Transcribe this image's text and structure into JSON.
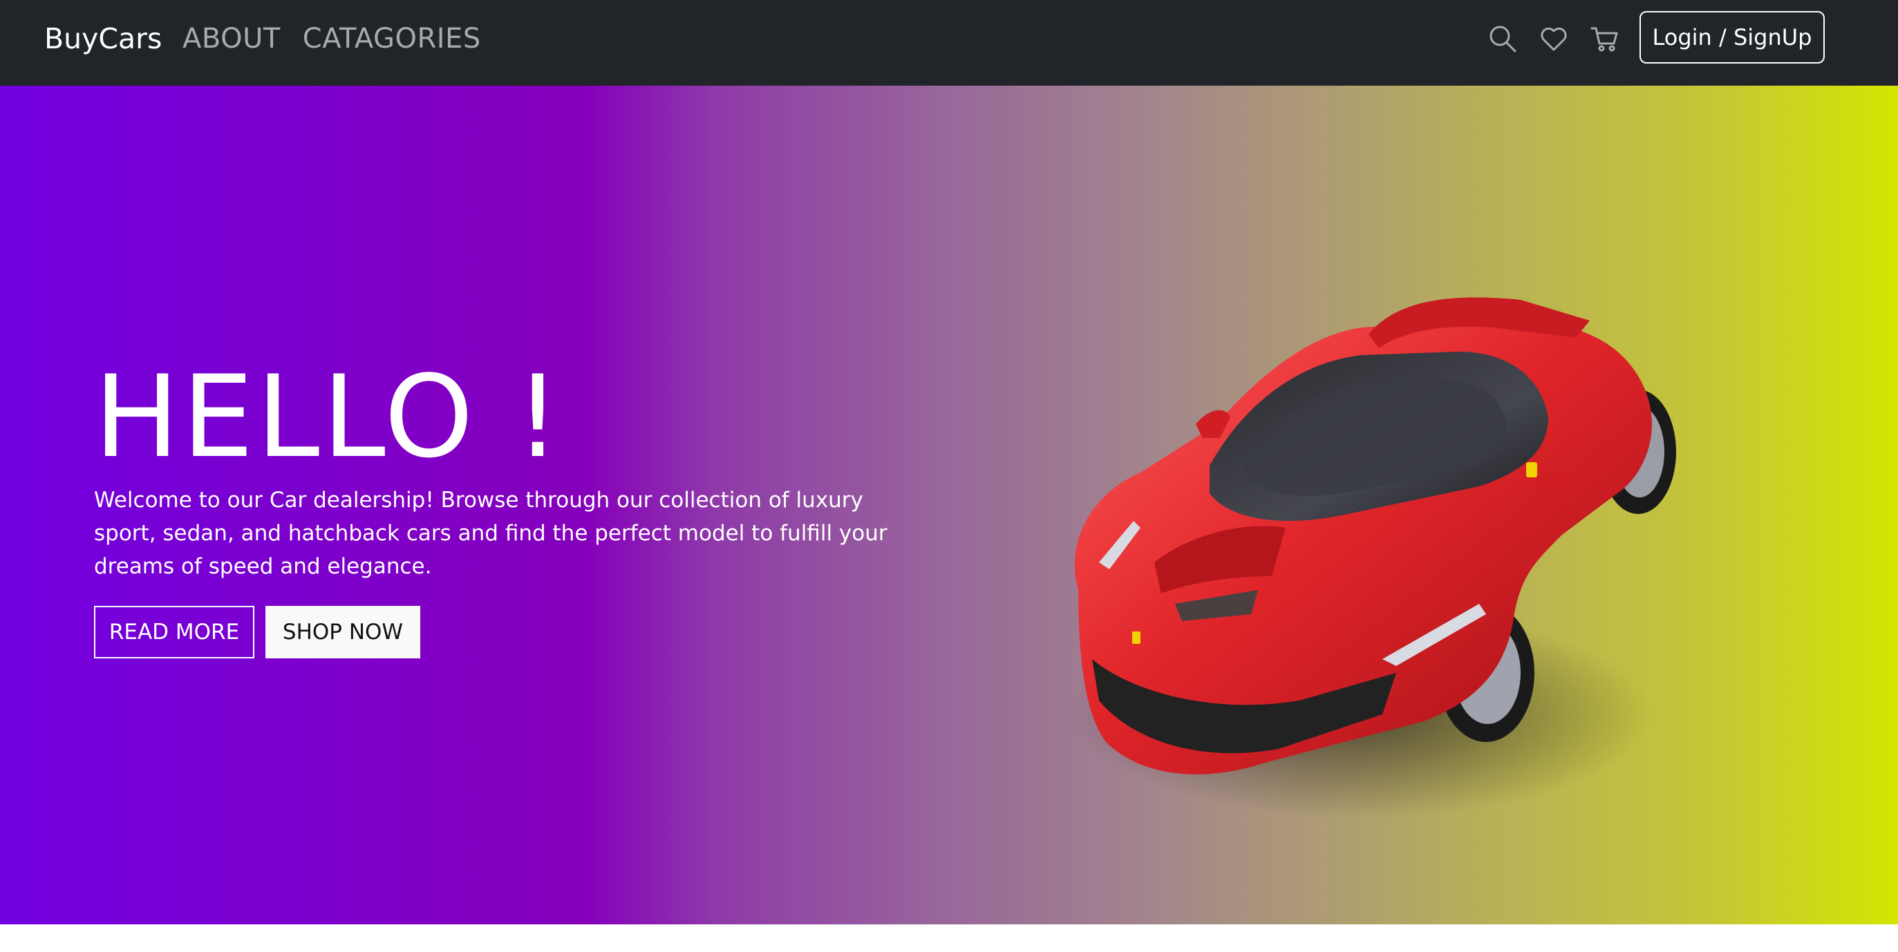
{
  "nav": {
    "brand": "BuyCars",
    "links": [
      "ABOUT",
      "CATAGORIES"
    ],
    "icons": [
      "search-icon",
      "heart-icon",
      "cart-icon"
    ],
    "login_label": "Login / SignUp"
  },
  "hero": {
    "title": "HELLO !",
    "description": "Welcome to our Car dealership! Browse through our collection of luxury sport, sedan, and hatchback cars and find the perfect model to fulfill your dreams of speed and elegance.",
    "read_more_label": "READ MORE",
    "shop_now_label": "SHOP NOW"
  },
  "colors": {
    "navbar": "#212428",
    "gradient_start": "#7200e0",
    "gradient_end": "#d3e600",
    "car_body": "#e0252a"
  }
}
